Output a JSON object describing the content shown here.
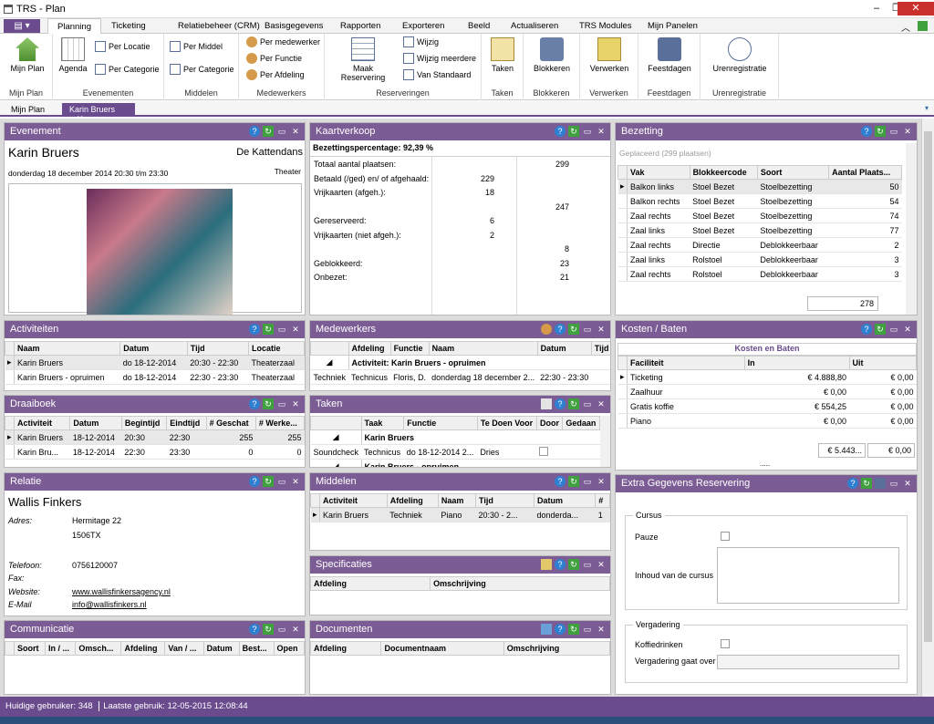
{
  "window": {
    "title": "TRS - Plan",
    "min": "–",
    "max": "❐",
    "close": "✕"
  },
  "menu": {
    "file": "▤ ▾",
    "tabs": [
      "Planning",
      "Ticketing",
      "Relatiebeheer (CRM)",
      "Basisgegevens",
      "Rapporten",
      "Exporteren",
      "Beeld",
      "Actualiseren",
      "TRS Modules",
      "Mijn Panelen"
    ]
  },
  "ribbon": {
    "mijnplan": {
      "btn": "Mijn Plan",
      "group": "Mijn Plan"
    },
    "evenementen": {
      "agenda": "Agenda",
      "per_locatie": "Per Locatie",
      "per_categorie": "Per Categorie",
      "group": "Evenementen"
    },
    "middelen": {
      "per_middel": "Per Middel",
      "per_categorie": "Per Categorie",
      "group": "Middelen"
    },
    "medewerkers": {
      "per_medewerker": "Per medewerker",
      "per_functie": "Per Functie",
      "per_afdeling": "Per Afdeling",
      "group": "Medewerkers"
    },
    "reserveringen": {
      "maak": "Maak Reservering",
      "wijzig": "Wijzig",
      "wijzig_meerdere": "Wijzig meerdere",
      "van_standaard": "Van Standaard",
      "group": "Reserveringen"
    },
    "taken": {
      "btn": "Taken",
      "group": "Taken"
    },
    "blokkeren": {
      "btn": "Blokkeren",
      "group": "Blokkeren"
    },
    "verwerken": {
      "btn": "Verwerken",
      "group": "Verwerken"
    },
    "feestdagen": {
      "btn": "Feestdagen",
      "group": "Feestdagen"
    },
    "uren": {
      "btn": "Urenregistratie",
      "group": "Urenregistratie"
    }
  },
  "doctabs": {
    "tab1": "Mijn Plan",
    "tab2": "Karin Bruers",
    "close": "✕"
  },
  "evenement": {
    "title": "Evenement",
    "name": "Karin Bruers",
    "show": "De Kattendans",
    "datetime": "donderdag 18 december 2014 20:30 t/m 23:30",
    "genre": "Theater"
  },
  "kaartverkoop": {
    "title": "Kaartverkoop",
    "pct_label": "Bezettingspercentage: 92,39 %",
    "rows": [
      {
        "label": "Totaal aantal plaatsen:",
        "v1": "",
        "v2": "299"
      },
      {
        "label": "Betaald (/ged) en/ of afgehaald:",
        "v1": "229",
        "v2": ""
      },
      {
        "label": "Vrijkaarten (afgeh.):",
        "v1": "18",
        "v2": ""
      },
      {
        "label": "",
        "v1": "",
        "v2": "247"
      },
      {
        "label": "Gereserveerd:",
        "v1": "6",
        "v2": ""
      },
      {
        "label": "Vrijkaarten (niet afgeh.):",
        "v1": "2",
        "v2": ""
      },
      {
        "label": "",
        "v1": "",
        "v2": "8"
      },
      {
        "label": "Geblokkeerd:",
        "v1": "",
        "v2": "23"
      },
      {
        "label": "Onbezet:",
        "v1": "",
        "v2": "21"
      }
    ]
  },
  "bezetting": {
    "title": "Bezetting",
    "placeholder": "Geplaceerd  (299 plaatsen)",
    "cols": [
      "Vak",
      "Blokkeercode",
      "Soort",
      "Aantal Plaats..."
    ],
    "rows": [
      [
        "Balkon links",
        "Stoel Bezet",
        "Stoelbezetting",
        "50"
      ],
      [
        "Balkon rechts",
        "Stoel Bezet",
        "Stoelbezetting",
        "54"
      ],
      [
        "Zaal rechts",
        "Stoel Bezet",
        "Stoelbezetting",
        "74"
      ],
      [
        "Zaal links",
        "Stoel Bezet",
        "Stoelbezetting",
        "77"
      ],
      [
        "Zaal rechts",
        "Directie",
        "Deblokkeerbaar",
        "2"
      ],
      [
        "Zaal links",
        "Rolstoel",
        "Deblokkeerbaar",
        "3"
      ],
      [
        "Zaal rechts",
        "Rolstoel",
        "Deblokkeerbaar",
        "3"
      ]
    ],
    "total": "278"
  },
  "activiteiten": {
    "title": "Activiteiten",
    "cols": [
      "Naam",
      "Datum",
      "Tijd",
      "Locatie"
    ],
    "rows": [
      [
        "Karin Bruers",
        "do 18-12-2014",
        "20:30 - 22:30",
        "Theaterzaal"
      ],
      [
        "Karin Bruers - opruimen",
        "do 18-12-2014",
        "22:30 - 23:30",
        "Theaterzaal"
      ]
    ]
  },
  "medewerkers": {
    "title": "Medewerkers",
    "cols": [
      "Afdeling",
      "Functie",
      "Naam",
      "Datum",
      "Tijd"
    ],
    "group": "Activiteit: Karin Bruers - opruimen",
    "rows": [
      [
        "Techniek",
        "Technicus",
        "Floris, D.",
        "donderdag 18 december 2...",
        "22:30 - 23:30"
      ]
    ]
  },
  "kosten": {
    "title": "Kosten / Baten",
    "subtitle": "Kosten en Baten",
    "cols": [
      "Faciliteit",
      "In",
      "Uit"
    ],
    "rows": [
      [
        "Ticketing",
        "€ 4.888,80",
        "€ 0,00"
      ],
      [
        "Zaalhuur",
        "€ 0,00",
        "€ 0,00"
      ],
      [
        "Gratis koffie",
        "€ 554,25",
        "€ 0,00"
      ],
      [
        "Piano",
        "€ 0,00",
        "€ 0,00"
      ]
    ],
    "total_in": "€ 5.443...",
    "total_uit": "€ 0,00",
    "dots": "....."
  },
  "draaiboek": {
    "title": "Draaiboek",
    "cols": [
      "Activiteit",
      "Datum",
      "Begintijd",
      "Eindtijd",
      "# Geschat",
      "# Werke..."
    ],
    "rows": [
      [
        "Karin Bruers",
        "18-12-2014",
        "20:30",
        "22:30",
        "255",
        "255"
      ],
      [
        "Karin Bru...",
        "18-12-2014",
        "22:30",
        "23:30",
        "0",
        "0"
      ]
    ]
  },
  "taken": {
    "title": "Taken",
    "cols": [
      "Taak",
      "Functie",
      "Te Doen Voor",
      "Door",
      "Gedaan"
    ],
    "group": "Karin Bruers",
    "rows": [
      [
        "Soundcheck",
        "Technicus",
        "do 18-12-2014 2...",
        "Dries",
        ""
      ]
    ],
    "group2": "Karin Bruers - opruimen"
  },
  "relatie": {
    "title": "Relatie",
    "name": "Wallis Finkers",
    "adres_label": "Adres:",
    "adres1": "Hermitage 22",
    "adres2": "1506TX",
    "tel_label": "Telefoon:",
    "tel": "0756120007",
    "fax_label": "Fax:",
    "web_label": "Website:",
    "web": "www.wallisfinkersagency.nl",
    "mail_label": "E-Mail",
    "mail": "info@wallisfinkers.nl"
  },
  "middelen": {
    "title": "Middelen",
    "cols": [
      "Activiteit",
      "Afdeling",
      "Naam",
      "Tijd",
      "Datum",
      "#"
    ],
    "rows": [
      [
        "Karin Bruers",
        "Techniek",
        "Piano",
        "20:30 - 2...",
        "donderda...",
        "1"
      ]
    ]
  },
  "extra": {
    "title": "Extra Gegevens Reservering",
    "cursus": "Cursus",
    "pauze": "Pauze",
    "inhoud": "Inhoud van de cursus",
    "vergadering": "Vergadering",
    "koffie": "Koffiedrinken",
    "over": "Vergadering gaat over"
  },
  "specificaties": {
    "title": "Specificaties",
    "cols": [
      "Afdeling",
      "Omschrijving"
    ]
  },
  "communicatie": {
    "title": "Communicatie",
    "cols": [
      "Soort",
      "In / ...",
      "Omsch...",
      "Afdeling",
      "Van / ...",
      "Datum",
      "Best...",
      "Open"
    ]
  },
  "documenten": {
    "title": "Documenten",
    "cols": [
      "Afdeling",
      "Documentnaam",
      "Omschrijving"
    ]
  },
  "status": {
    "users": "Huidige gebruiker: 348",
    "last": "Laatste gebruik: 12-05-2015 12:08:44"
  }
}
